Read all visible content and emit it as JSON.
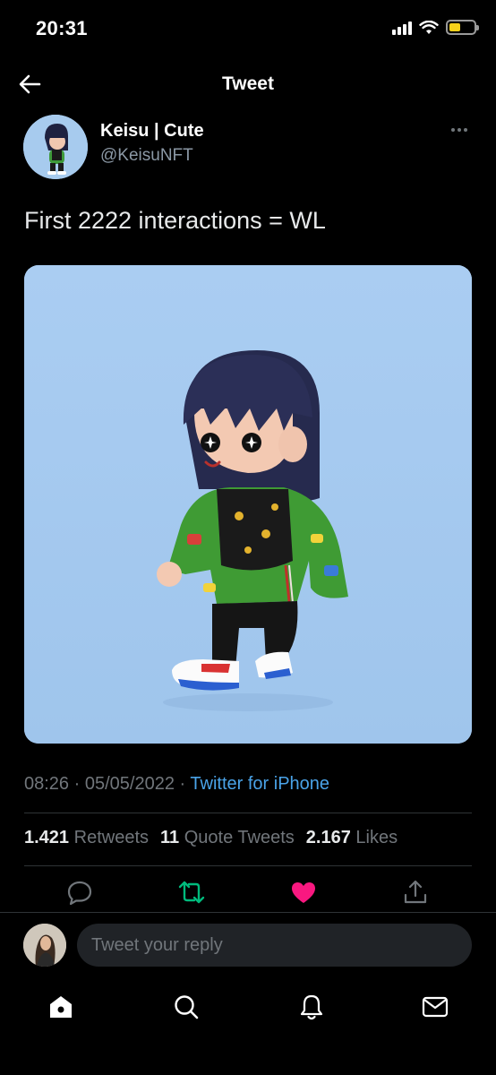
{
  "status_bar": {
    "time": "20:31",
    "battery_level": 0.45,
    "battery_color": "#f7d21a",
    "icons": [
      "cellular-signal-icon",
      "wifi-icon",
      "battery-icon"
    ]
  },
  "header": {
    "title": "Tweet",
    "back_icon": "arrow-left-icon"
  },
  "tweet": {
    "author_name": "Keisu | Cute",
    "author_handle": "@KeisuNFT",
    "text": "First 2222 interactions = WL",
    "time": "08:26",
    "separator": "·",
    "date": "05/05/2022",
    "source": "Twitter for iPhone",
    "source_color": "#4aa3e8",
    "stats": {
      "retweets_count": "1.421",
      "retweets_label": "Retweets",
      "quote_count": "11",
      "quote_label": "Quote Tweets",
      "likes_count": "2.167",
      "likes_label": "Likes"
    },
    "actions": [
      "reply-icon",
      "retweet-icon",
      "like-icon",
      "share-icon"
    ],
    "liked": true,
    "retweeted": true,
    "like_color": "#f91880",
    "retweet_color": "#00ba7c"
  },
  "reply": {
    "placeholder": "Tweet your reply"
  },
  "tabbar": {
    "items": [
      "home-icon",
      "search-icon",
      "notifications-icon",
      "messages-icon"
    ]
  }
}
